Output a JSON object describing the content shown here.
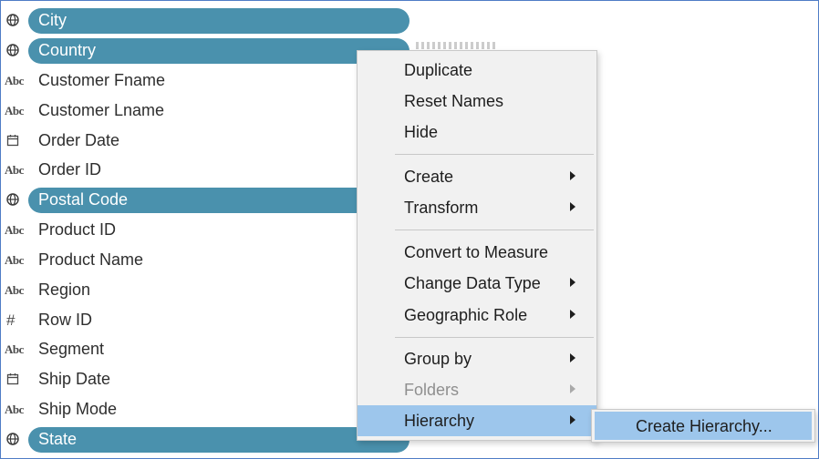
{
  "fields": [
    {
      "label": "City",
      "icon": "globe-icon",
      "selected": true
    },
    {
      "label": "Country",
      "icon": "globe-icon",
      "selected": true
    },
    {
      "label": "Customer Fname",
      "icon": "abc-icon",
      "selected": false
    },
    {
      "label": "Customer Lname",
      "icon": "abc-icon",
      "selected": false
    },
    {
      "label": "Order Date",
      "icon": "calendar-icon",
      "selected": false
    },
    {
      "label": "Order ID",
      "icon": "abc-icon",
      "selected": false
    },
    {
      "label": "Postal Code",
      "icon": "globe-icon",
      "selected": true
    },
    {
      "label": "Product ID",
      "icon": "abc-icon",
      "selected": false
    },
    {
      "label": "Product Name",
      "icon": "abc-icon",
      "selected": false
    },
    {
      "label": "Region",
      "icon": "abc-icon",
      "selected": false
    },
    {
      "label": "Row ID",
      "icon": "hash-icon",
      "selected": false
    },
    {
      "label": "Segment",
      "icon": "abc-icon",
      "selected": false
    },
    {
      "label": "Ship Date",
      "icon": "calendar-icon",
      "selected": false
    },
    {
      "label": "Ship Mode",
      "icon": "abc-icon",
      "selected": false
    },
    {
      "label": "State",
      "icon": "globe-icon",
      "selected": true
    }
  ],
  "icons": {
    "abc": "Abc",
    "hash": "#"
  },
  "context_menu": {
    "duplicate": "Duplicate",
    "reset_names": "Reset Names",
    "hide": "Hide",
    "create": "Create",
    "transform": "Transform",
    "convert_to_measure": "Convert to Measure",
    "change_data_type": "Change Data Type",
    "geographic_role": "Geographic Role",
    "group_by": "Group by",
    "folders": "Folders",
    "hierarchy": "Hierarchy"
  },
  "submenu": {
    "create_hierarchy": "Create Hierarchy..."
  },
  "colors": {
    "selection": "#4a91ad",
    "menu_highlight": "#9dc6ec",
    "menu_background": "#f1f1f1",
    "frame_border": "#4f7cc6"
  }
}
